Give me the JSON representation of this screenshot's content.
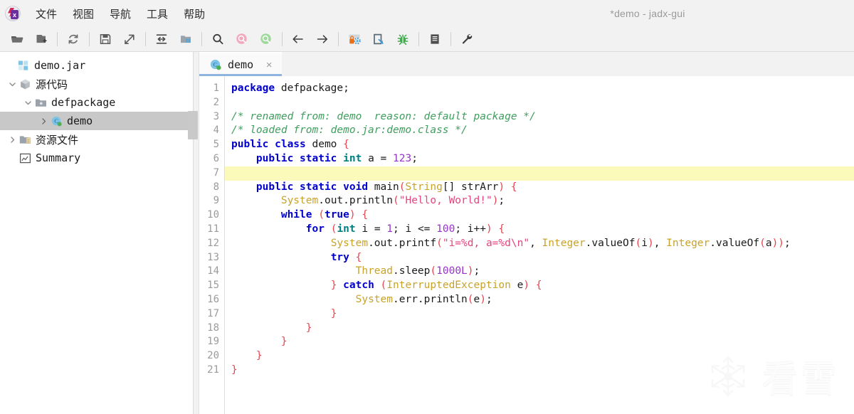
{
  "window": {
    "title": "*demo - jadx-gui",
    "app_icon": "jadx-logo-icon"
  },
  "menubar": {
    "items": [
      {
        "label": "文件",
        "name": "menu-file"
      },
      {
        "label": "视图",
        "name": "menu-view"
      },
      {
        "label": "导航",
        "name": "menu-navigation"
      },
      {
        "label": "工具",
        "name": "menu-tools"
      },
      {
        "label": "帮助",
        "name": "menu-help"
      }
    ]
  },
  "toolbar": {
    "buttons": [
      {
        "icon": "open-folder-icon",
        "title": "打开文件"
      },
      {
        "icon": "add-files-icon",
        "title": "添加文件"
      },
      {
        "sep": true
      },
      {
        "icon": "reload-icon",
        "title": "重新加载"
      },
      {
        "sep": true
      },
      {
        "icon": "save-icon",
        "title": "保存"
      },
      {
        "icon": "export-icon",
        "title": "全部保存"
      },
      {
        "sep": true
      },
      {
        "icon": "collapse-all-icon",
        "title": "折叠全部"
      },
      {
        "icon": "flat-packages-icon",
        "title": "平铺包"
      },
      {
        "sep": true
      },
      {
        "icon": "search-icon",
        "title": "搜索"
      },
      {
        "icon": "search-class-icon",
        "title": "类搜索"
      },
      {
        "icon": "search-comment-icon",
        "title": "注释搜索"
      },
      {
        "sep": true
      },
      {
        "icon": "back-arrow-icon",
        "title": "后退"
      },
      {
        "icon": "forward-arrow-icon",
        "title": "前进"
      },
      {
        "sep": true
      },
      {
        "icon": "deobfuscation-icon",
        "title": "反混淆"
      },
      {
        "icon": "quark-icon",
        "title": "Quark 分析"
      },
      {
        "icon": "debugger-icon",
        "title": "调试器"
      },
      {
        "sep": true
      },
      {
        "icon": "log-icon",
        "title": "日志"
      },
      {
        "sep": true
      },
      {
        "icon": "preferences-icon",
        "title": "首选项"
      }
    ]
  },
  "sidebar": {
    "tree": [
      {
        "label": "demo.jar",
        "icon": "jar-icon",
        "indent": 0,
        "twisty": "",
        "selected": false,
        "cn": false
      },
      {
        "label": "源代码",
        "icon": "package-icon",
        "indent": 1,
        "twisty": "open",
        "selected": false,
        "cn": true
      },
      {
        "label": "defpackage",
        "icon": "folder-icon",
        "indent": 2,
        "twisty": "open",
        "selected": false,
        "cn": false
      },
      {
        "label": "demo",
        "icon": "class-icon",
        "indent": 3,
        "twisty": "closed",
        "selected": true,
        "cn": false
      },
      {
        "label": "资源文件",
        "icon": "resources-icon",
        "indent": 1,
        "twisty": "closed",
        "selected": false,
        "cn": true
      },
      {
        "label": "Summary",
        "icon": "summary-icon",
        "indent": 1,
        "twisty": "",
        "selected": false,
        "cn": false
      }
    ]
  },
  "tabs": [
    {
      "label": "demo",
      "icon": "class-icon",
      "active": true,
      "close": "×"
    }
  ],
  "editor": {
    "current_line": 7,
    "line_numbers": [
      1,
      2,
      3,
      4,
      5,
      6,
      7,
      8,
      9,
      10,
      11,
      12,
      13,
      14,
      15,
      16,
      17,
      18,
      19,
      20,
      21
    ],
    "lines": [
      {
        "n": 1,
        "tokens": [
          {
            "t": "package",
            "c": "k"
          },
          {
            "t": " defpackage",
            "c": "df"
          },
          {
            "t": ";",
            "c": "df"
          }
        ]
      },
      {
        "n": 2,
        "tokens": []
      },
      {
        "n": 3,
        "tokens": [
          {
            "t": "/* renamed from: demo  reason: default package */",
            "c": "cm"
          }
        ]
      },
      {
        "n": 4,
        "tokens": [
          {
            "t": "/* loaded from: demo.jar:demo.class */",
            "c": "cm"
          }
        ]
      },
      {
        "n": 5,
        "tokens": [
          {
            "t": "public class",
            "c": "k"
          },
          {
            "t": " demo ",
            "c": "df"
          },
          {
            "t": "{",
            "c": "pn"
          }
        ]
      },
      {
        "n": 6,
        "tokens": [
          {
            "t": "    ",
            "c": "df"
          },
          {
            "t": "public static ",
            "c": "k"
          },
          {
            "t": "int",
            "c": "kt"
          },
          {
            "t": " a = ",
            "c": "df"
          },
          {
            "t": "123",
            "c": "nm"
          },
          {
            "t": ";",
            "c": "df"
          }
        ]
      },
      {
        "n": 7,
        "tokens": []
      },
      {
        "n": 8,
        "tokens": [
          {
            "t": "    ",
            "c": "df"
          },
          {
            "t": "public static void",
            "c": "k"
          },
          {
            "t": " main",
            "c": "df"
          },
          {
            "t": "(",
            "c": "pn"
          },
          {
            "t": "String",
            "c": "cl"
          },
          {
            "t": "[] strArr",
            "c": "df"
          },
          {
            "t": ")",
            "c": "pn"
          },
          {
            "t": " ",
            "c": "df"
          },
          {
            "t": "{",
            "c": "pn"
          }
        ]
      },
      {
        "n": 9,
        "tokens": [
          {
            "t": "        ",
            "c": "df"
          },
          {
            "t": "System",
            "c": "cl"
          },
          {
            "t": ".out.println",
            "c": "df"
          },
          {
            "t": "(",
            "c": "pn"
          },
          {
            "t": "\"Hello, World!\"",
            "c": "st"
          },
          {
            "t": ")",
            "c": "pn"
          },
          {
            "t": ";",
            "c": "df"
          }
        ]
      },
      {
        "n": 10,
        "tokens": [
          {
            "t": "        ",
            "c": "df"
          },
          {
            "t": "while",
            "c": "k"
          },
          {
            "t": " ",
            "c": "df"
          },
          {
            "t": "(",
            "c": "pn"
          },
          {
            "t": "true",
            "c": "k"
          },
          {
            "t": ")",
            "c": "pn"
          },
          {
            "t": " ",
            "c": "df"
          },
          {
            "t": "{",
            "c": "pn"
          }
        ]
      },
      {
        "n": 11,
        "tokens": [
          {
            "t": "            ",
            "c": "df"
          },
          {
            "t": "for",
            "c": "k"
          },
          {
            "t": " ",
            "c": "df"
          },
          {
            "t": "(",
            "c": "pn"
          },
          {
            "t": "int",
            "c": "kt"
          },
          {
            "t": " i = ",
            "c": "df"
          },
          {
            "t": "1",
            "c": "nm"
          },
          {
            "t": "; i <= ",
            "c": "df"
          },
          {
            "t": "100",
            "c": "nm"
          },
          {
            "t": "; i++",
            "c": "df"
          },
          {
            "t": ")",
            "c": "pn"
          },
          {
            "t": " ",
            "c": "df"
          },
          {
            "t": "{",
            "c": "pn"
          }
        ]
      },
      {
        "n": 12,
        "tokens": [
          {
            "t": "                ",
            "c": "df"
          },
          {
            "t": "System",
            "c": "cl"
          },
          {
            "t": ".out.printf",
            "c": "df"
          },
          {
            "t": "(",
            "c": "pn"
          },
          {
            "t": "\"i=%d, a=%d\\n\"",
            "c": "st"
          },
          {
            "t": ", ",
            "c": "df"
          },
          {
            "t": "Integer",
            "c": "cl"
          },
          {
            "t": ".valueOf",
            "c": "df"
          },
          {
            "t": "(",
            "c": "pn"
          },
          {
            "t": "i",
            "c": "df"
          },
          {
            "t": ")",
            "c": "pn"
          },
          {
            "t": ", ",
            "c": "df"
          },
          {
            "t": "Integer",
            "c": "cl"
          },
          {
            "t": ".valueOf",
            "c": "df"
          },
          {
            "t": "(",
            "c": "pn"
          },
          {
            "t": "a",
            "c": "df"
          },
          {
            "t": "))",
            "c": "pn"
          },
          {
            "t": ";",
            "c": "df"
          }
        ]
      },
      {
        "n": 13,
        "tokens": [
          {
            "t": "                ",
            "c": "df"
          },
          {
            "t": "try",
            "c": "k"
          },
          {
            "t": " ",
            "c": "df"
          },
          {
            "t": "{",
            "c": "pn"
          }
        ]
      },
      {
        "n": 14,
        "tokens": [
          {
            "t": "                    ",
            "c": "df"
          },
          {
            "t": "Thread",
            "c": "cl"
          },
          {
            "t": ".sleep",
            "c": "df"
          },
          {
            "t": "(",
            "c": "pn"
          },
          {
            "t": "1000L",
            "c": "nm"
          },
          {
            "t": ")",
            "c": "pn"
          },
          {
            "t": ";",
            "c": "df"
          }
        ]
      },
      {
        "n": 15,
        "tokens": [
          {
            "t": "                ",
            "c": "df"
          },
          {
            "t": "}",
            "c": "pn"
          },
          {
            "t": " ",
            "c": "df"
          },
          {
            "t": "catch",
            "c": "k"
          },
          {
            "t": " ",
            "c": "df"
          },
          {
            "t": "(",
            "c": "pn"
          },
          {
            "t": "InterruptedException",
            "c": "cl"
          },
          {
            "t": " e",
            "c": "df"
          },
          {
            "t": ")",
            "c": "pn"
          },
          {
            "t": " ",
            "c": "df"
          },
          {
            "t": "{",
            "c": "pn"
          }
        ]
      },
      {
        "n": 16,
        "tokens": [
          {
            "t": "                    ",
            "c": "df"
          },
          {
            "t": "System",
            "c": "cl"
          },
          {
            "t": ".err.println",
            "c": "df"
          },
          {
            "t": "(",
            "c": "pn"
          },
          {
            "t": "e",
            "c": "df"
          },
          {
            "t": ")",
            "c": "pn"
          },
          {
            "t": ";",
            "c": "df"
          }
        ]
      },
      {
        "n": 17,
        "tokens": [
          {
            "t": "                ",
            "c": "df"
          },
          {
            "t": "}",
            "c": "pn"
          }
        ]
      },
      {
        "n": 18,
        "tokens": [
          {
            "t": "            ",
            "c": "df"
          },
          {
            "t": "}",
            "c": "pn"
          }
        ]
      },
      {
        "n": 19,
        "tokens": [
          {
            "t": "        ",
            "c": "df"
          },
          {
            "t": "}",
            "c": "pn"
          }
        ]
      },
      {
        "n": 20,
        "tokens": [
          {
            "t": "    ",
            "c": "df"
          },
          {
            "t": "}",
            "c": "pn"
          }
        ]
      },
      {
        "n": 21,
        "tokens": [
          {
            "t": "}",
            "c": "pn"
          }
        ]
      }
    ]
  },
  "watermark": {
    "text": "看雪",
    "icon": "snowflake-icon"
  },
  "colors": {
    "keyword": "#0000cc",
    "type": "#008080",
    "comment": "#3f9e5e",
    "string": "#e4447f",
    "number": "#9933cc",
    "class_ref": "#c9a227",
    "punctuation": "#e8434f",
    "current_line_bg": "#fcfaba",
    "selection_bg": "#c8c8c8",
    "chrome_bg": "#f2f2f2"
  }
}
